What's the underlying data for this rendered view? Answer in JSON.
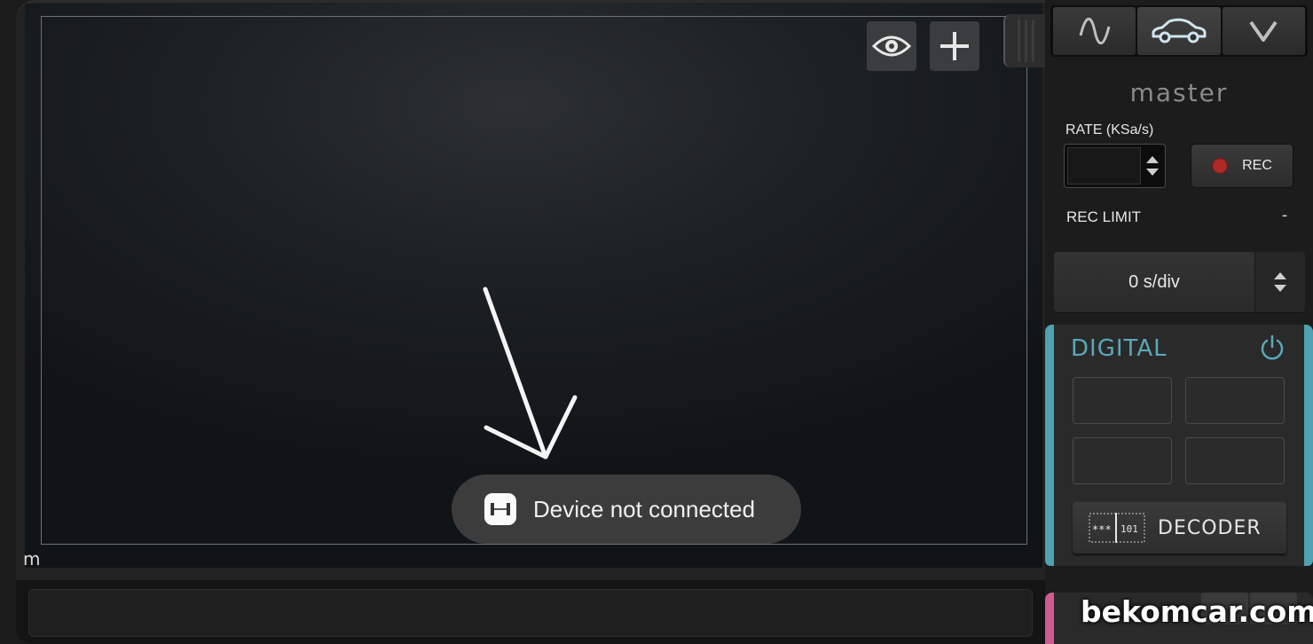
{
  "plot": {
    "units_label": "m",
    "toolbar": {
      "eye_icon": "eye-icon",
      "add_icon": "plus-icon"
    }
  },
  "toast": {
    "message": "Device not connected",
    "icon": "app-icon"
  },
  "sidebar": {
    "mode_tabs": [
      {
        "icon": "sine-wave-icon",
        "active": false
      },
      {
        "icon": "car-icon",
        "active": true
      },
      {
        "icon": "chevron-down-icon",
        "active": false
      }
    ],
    "title": "master",
    "rate_label": "RATE (KSa/s)",
    "rate_value": "",
    "rec_label": "REC",
    "rec_limit_label": "REC LIMIT",
    "rec_limit_value": "-",
    "timebase_value": "0 s/div",
    "digital": {
      "title": "DIGITAL",
      "decoder_label": "DECODER",
      "decoder_icon_text_left": "***",
      "decoder_icon_text_right": "101",
      "accent": "#4fa2b0"
    },
    "next_panel_accent": "#d05a92"
  },
  "watermark": "bekomcar.com"
}
